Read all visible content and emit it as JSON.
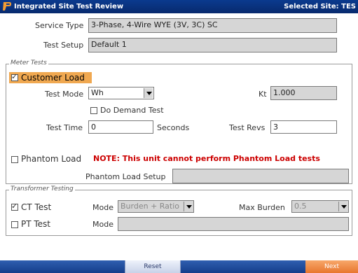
{
  "window": {
    "title": "Integrated Site Test Review",
    "selected_site": "Selected Site: TES"
  },
  "top": {
    "service_type_label": "Service Type",
    "service_type_value": "3-Phase, 4-Wire WYE (3V, 3C) SC",
    "test_setup_label": "Test Setup",
    "test_setup_value": "Default 1"
  },
  "meter_tests": {
    "group_title": "Meter Tests",
    "customer_load_label": "Customer Load",
    "customer_load_checked": true,
    "test_mode_label": "Test Mode",
    "test_mode_value": "Wh",
    "kt_label": "Kt",
    "kt_value": "1.000",
    "demand_label": "Do Demand Test",
    "demand_checked": false,
    "test_time_label": "Test Time",
    "test_time_value": "0",
    "seconds_label": "Seconds",
    "test_revs_label": "Test Revs",
    "test_revs_value": "3",
    "phantom_label": "Phantom Load",
    "phantom_checked": false,
    "phantom_note": "NOTE: This unit cannot perform Phantom Load tests",
    "phantom_setup_label": "Phantom Load Setup",
    "phantom_setup_value": ""
  },
  "transformer": {
    "group_title": "Transformer Testing",
    "ct_label": "CT Test",
    "ct_checked": true,
    "ct_mode_label": "Mode",
    "ct_mode_value": "Burden + Ratio",
    "max_burden_label": "Max Burden",
    "max_burden_value": "0.5",
    "pt_label": "PT Test",
    "pt_checked": false,
    "pt_mode_label": "Mode",
    "pt_mode_value": ""
  },
  "footer": {
    "reset_label": "Reset",
    "next_label": "Next"
  },
  "colors": {
    "titlebar": "#0a3a8e",
    "note_red": "#cc0000",
    "next_orange": "#e8762e",
    "customer_load_highlight": "#f0a850"
  }
}
